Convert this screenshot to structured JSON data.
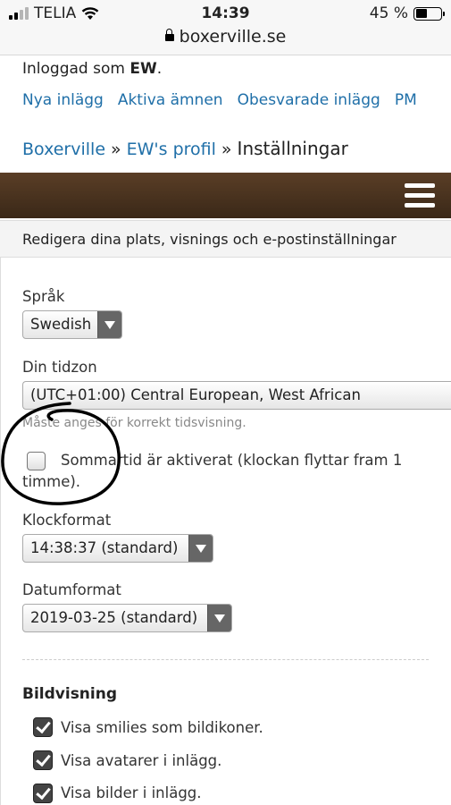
{
  "status_bar": {
    "carrier": "TELIA",
    "time": "14:39",
    "battery_percent": "45 %",
    "battery_level": 0.45
  },
  "url_bar": {
    "domain": "boxerville.se"
  },
  "user": {
    "prefix": "Inloggad som",
    "name": "EW",
    "suffix": "."
  },
  "nav": [
    "Nya inlägg",
    "Aktiva ämnen",
    "Obesvarade inlägg",
    "PM"
  ],
  "breadcrumb": {
    "root": "Boxerville",
    "separator": "»",
    "profile": "EW's profil",
    "current": "Inställningar"
  },
  "form": {
    "header": "Redigera dina plats, visnings och e-postinställningar",
    "language": {
      "label": "Språk",
      "value": "Swedish"
    },
    "timezone": {
      "label": "Din tidzon",
      "value": "(UTC+01:00) Central European, West African",
      "hint": "Måste anges för korrekt tidsvisning."
    },
    "dst": {
      "label": "Sommartid är aktiverat (klockan flyttar fram 1 timme).",
      "checked": false
    },
    "time_format": {
      "label": "Klockformat",
      "value": "14:38:37 (standard)"
    },
    "date_format": {
      "label": "Datumformat",
      "value": "2019-03-25 (standard)"
    }
  },
  "image_display": {
    "title": "Bildvisning",
    "options": [
      {
        "label": "Visa smilies som bildikoner.",
        "checked": true
      },
      {
        "label": "Visa avatarer i inlägg.",
        "checked": true
      },
      {
        "label": "Visa bilder i inlägg.",
        "checked": true
      }
    ]
  },
  "colors": {
    "link": "#1f6fa8",
    "banner": "#4a3220"
  }
}
